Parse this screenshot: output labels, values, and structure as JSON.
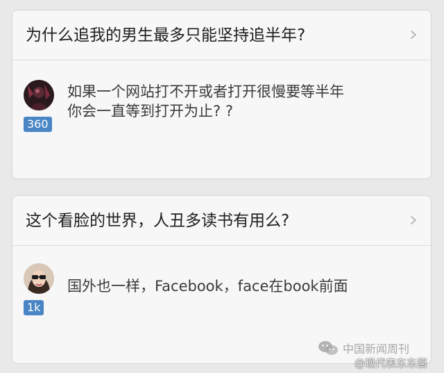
{
  "feed": [
    {
      "question": "为什么追我的男生最多只能坚持追半年?",
      "answer_lines": [
        "如果一个网站打不开或者打开很慢要等半年",
        "你会一直等到打开为止? ?"
      ],
      "votes": "360",
      "avatar_icon": "user-avatar-dark",
      "chevron_icon": "chevron-right-icon"
    },
    {
      "question": "这个看脸的世界，人丑多读书有用么?",
      "answer_lines": [
        "国外也一样，Facebook，face在book前面"
      ],
      "votes": "1k",
      "avatar_icon": "user-avatar-sunglasses",
      "chevron_icon": "chevron-right-icon"
    }
  ],
  "watermark": {
    "text": "中国新闻周刊",
    "icon": "wechat-icon",
    "signature": "@现代表东东酱"
  },
  "colors": {
    "background": "#e9e9e9",
    "card": "#f7f7f7",
    "badge": "#4a86c5"
  }
}
